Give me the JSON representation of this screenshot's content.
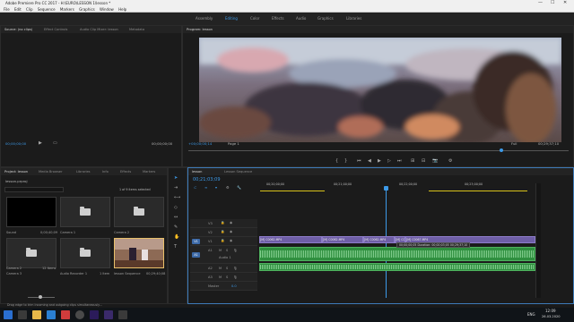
{
  "window": {
    "title": "Adobe Premiere Pro CC 2017 - H:\\EURO\\LESSON 1\\lesson *",
    "minimize": "—",
    "maximize": "☐",
    "close": "✕"
  },
  "menu": [
    "File",
    "Edit",
    "Clip",
    "Sequence",
    "Markers",
    "Graphics",
    "Window",
    "Help"
  ],
  "workspaces": [
    "Assembly",
    "Editing",
    "Color",
    "Effects",
    "Audio",
    "Graphics",
    "Libraries"
  ],
  "active_workspace": "Editing",
  "source_panel": {
    "tabs": [
      "Source: (no clips)",
      "Effect Controls",
      "Audio Clip Mixer: lesson",
      "Metadata"
    ],
    "timecode_left": "00;00;00;00",
    "timecode_right": "00;00;00;00"
  },
  "program_panel": {
    "tab": "Program: lesson",
    "timecode": "+00;00;00;14",
    "page": "Page 1",
    "fit": "Full",
    "duration": "00;29;37;10"
  },
  "project_panel": {
    "tabs": [
      "Project: lesson",
      "Media Browser",
      "Libraries",
      "Info",
      "Effects",
      "Markers"
    ],
    "path": "lesson.prproj",
    "selection": "1 of 9 items selected",
    "items": [
      {
        "name": "Sound",
        "info": "0;00;40;09",
        "type": "black"
      },
      {
        "name": "Camera 1",
        "info": "",
        "type": "folder"
      },
      {
        "name": "Camera 2",
        "info": "",
        "type": "folder"
      },
      {
        "name": "Camera 3",
        "info": "",
        "type": "folder"
      },
      {
        "name": "Camera 2",
        "info": "12 Items",
        "type": "folder"
      },
      {
        "name": "Audio Recorder 1",
        "info": "1 Item",
        "type": "folder"
      },
      {
        "name": "lesson Sequence",
        "info": "00;29;40;08",
        "type": "photo"
      }
    ]
  },
  "timeline": {
    "tabs": [
      "lesson",
      "Lesson Sequence"
    ],
    "timecode": "00;21;03;09",
    "ruler": [
      "00;20;00;00",
      "00;21;00;00",
      "00;22;00;00",
      "00;23;00;00"
    ],
    "tracks": [
      {
        "id": "V3",
        "kind": "video"
      },
      {
        "id": "V2",
        "kind": "video"
      },
      {
        "id": "V1",
        "kind": "video"
      },
      {
        "id": "A1",
        "kind": "audio",
        "name": "Audio 1"
      },
      {
        "id": "A2",
        "kind": "audio"
      },
      {
        "id": "A3",
        "kind": "audio"
      }
    ],
    "master_label": "Master",
    "master_value": "0.0",
    "clips": [
      "[M] C0062.MP4",
      "[M] C0062.MP4",
      "[M] C0062.MP4",
      "[M] C0062.MP4",
      "[M] C0067.MP4"
    ],
    "tooltip": "00;00;00;05 Duration: 00;00;03;05 00;29;37;10"
  },
  "status": "Drag edge to trim incoming and outgoing clips simultaneously...",
  "taskbar": {
    "lang": "ENG",
    "time": "12:09",
    "date": "26.03.2020"
  }
}
